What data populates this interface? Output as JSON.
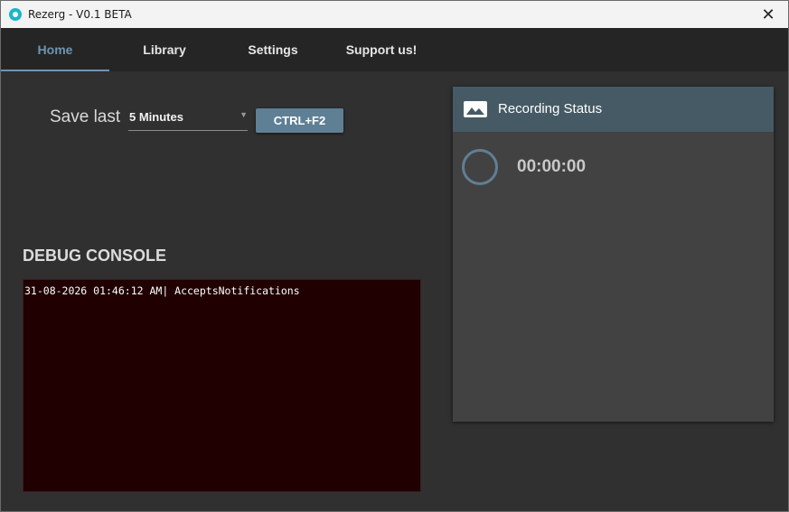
{
  "window": {
    "title": "Rezerg - V0.1 BETA",
    "close_glyph": "✕"
  },
  "tabs": [
    {
      "label": "Home",
      "active": true
    },
    {
      "label": "Library",
      "active": false
    },
    {
      "label": "Settings",
      "active": false
    },
    {
      "label": "Support us!",
      "active": false
    }
  ],
  "save": {
    "label": "Save last",
    "duration_selected": "5 Minutes",
    "hotkey_label": "CTRL+F2"
  },
  "debug": {
    "title": "DEBUG CONSOLE",
    "log_lines": [
      "31-08-2026 01:46:12 AM| AcceptsNotifications"
    ]
  },
  "recording": {
    "title": "Recording Status",
    "timer": "00:00:00"
  },
  "colors": {
    "accent": "#6e94b2",
    "card_header": "#455a64",
    "console_bg": "#200000",
    "app_icon": "#1ab6c9"
  },
  "icons": {
    "app": "rezerg-app-icon",
    "close": "close-icon",
    "status": "image-icon",
    "dropdown": "dropdown-arrow-icon"
  }
}
